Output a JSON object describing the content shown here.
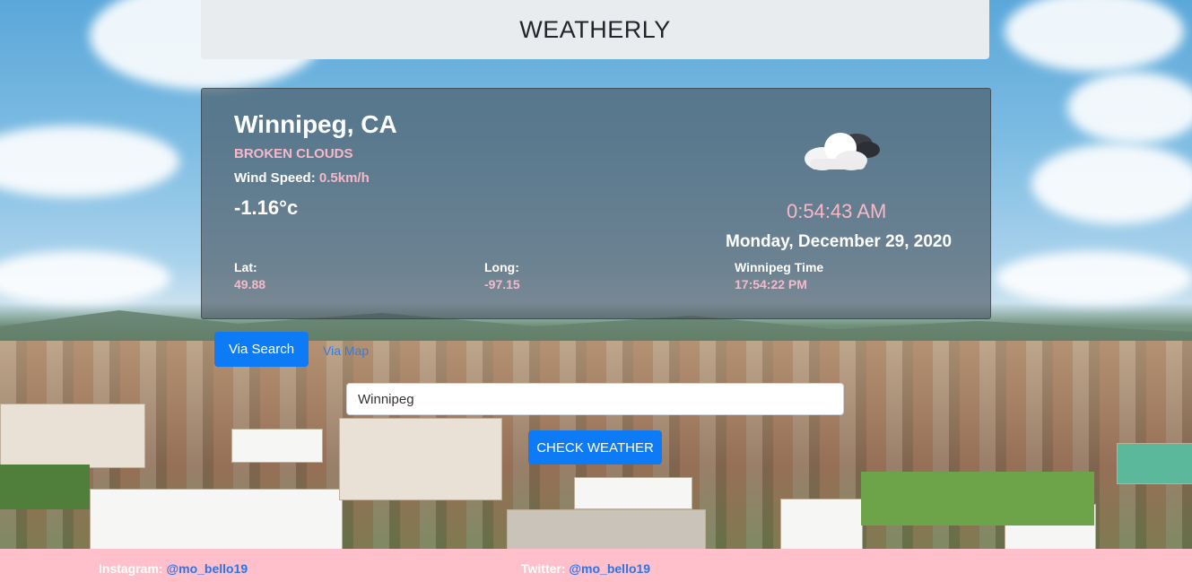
{
  "header": {
    "title": "WEATHERLY"
  },
  "weather": {
    "location": "Winnipeg, CA",
    "description": "BROKEN CLOUDS",
    "wind_label": "Wind Speed:",
    "wind_value": "0.5km/h",
    "temperature": "-1.16°c",
    "icon": "broken-clouds-icon",
    "local_time": "0:54:43 AM",
    "date": "Monday, December 29, 2020",
    "lat_label": "Lat:",
    "lat_value": "49.88",
    "long_label": "Long:",
    "long_value": "-97.15",
    "city_time_label": "Winnipeg Time",
    "city_time_value": "17:54:22 PM"
  },
  "controls": {
    "via_search_label": "Via Search",
    "via_map_label": "Via Map",
    "search_value": "Winnipeg",
    "check_label": "CHECK WEATHER"
  },
  "footer": {
    "instagram_label": "Instagram:",
    "instagram_handle": "@mo_bello19",
    "twitter_label": "Twitter:",
    "twitter_handle": "@mo_bello19"
  },
  "colors": {
    "accent_pink": "#f7b8c8",
    "button_blue": "#0d7bf5",
    "footer_bg": "#ffc0cb"
  }
}
